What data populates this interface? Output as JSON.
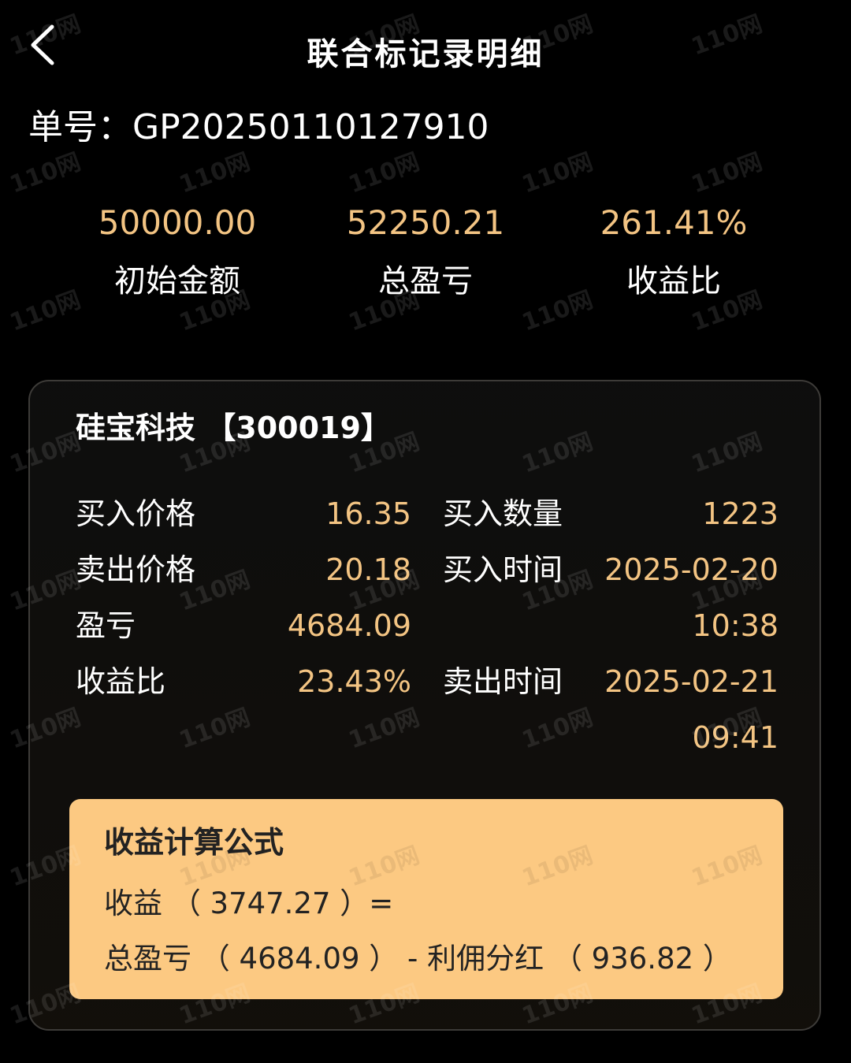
{
  "header": {
    "title": "联合标记录明细",
    "back_icon": "chevron-left-icon"
  },
  "order": {
    "label": "单号：",
    "number": "GP20250110127910"
  },
  "summary": [
    {
      "value": "50000.00",
      "label": "初始金额"
    },
    {
      "value": "52250.21",
      "label": "总盈亏"
    },
    {
      "value": "261.41%",
      "label": "收益比"
    }
  ],
  "card": {
    "stock_name": "硅宝科技",
    "stock_code": "【300019】",
    "rows": [
      {
        "l1": "买入价格",
        "v1": "16.35",
        "l2": "买入数量",
        "v2": "1223"
      },
      {
        "l1": "卖出价格",
        "v1": "20.18",
        "l2": "买入时间",
        "v2": "2025-02-20"
      },
      {
        "l1": "盈亏",
        "v1": "4684.09",
        "l2": "",
        "v2": "10:38"
      },
      {
        "l1": "收益比",
        "v1": "23.43%",
        "l2": "卖出时间",
        "v2": "2025-02-21"
      },
      {
        "l1": "",
        "v1": "",
        "l2": "",
        "v2": "09:41"
      }
    ]
  },
  "formula": {
    "title": "收益计算公式",
    "line1": "收益 （ 3747.27 ）=",
    "line2": "总盈亏 （ 4684.09 ） - 利佣分红 （ 936.82 ）"
  },
  "watermark": "110网",
  "colors": {
    "accent": "#f3c483",
    "formula_bg": "#fcc982",
    "background": "#000000"
  }
}
